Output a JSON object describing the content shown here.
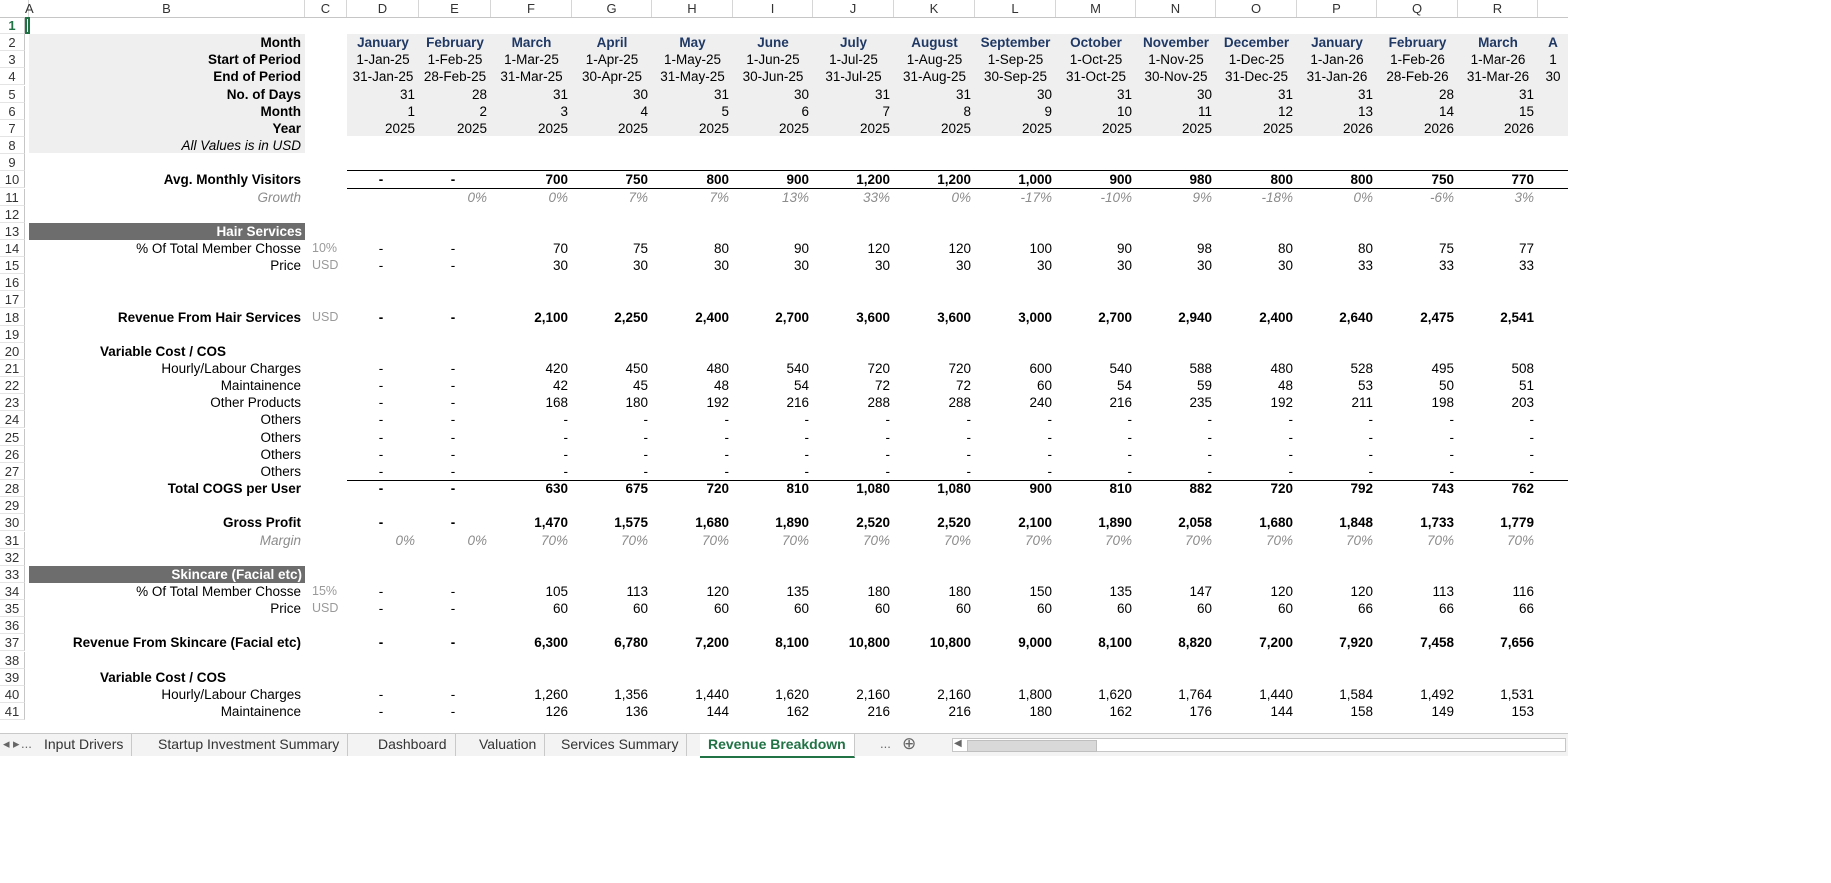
{
  "columns": [
    "A",
    "B",
    "C",
    "D",
    "E",
    "F",
    "G",
    "H",
    "I",
    "J",
    "K",
    "L",
    "M",
    "N",
    "O",
    "P",
    "Q",
    "R"
  ],
  "row_numbers": [
    "1",
    "2",
    "3",
    "4",
    "5",
    "6",
    "7",
    "8",
    "9",
    "10",
    "11",
    "12",
    "13",
    "14",
    "15",
    "16",
    "17",
    "18",
    "19",
    "20",
    "21",
    "22",
    "23",
    "24",
    "25",
    "26",
    "27",
    "28",
    "29",
    "30",
    "31",
    "32",
    "33",
    "34",
    "35",
    "36",
    "37",
    "38",
    "39",
    "40",
    "41"
  ],
  "header_rows": [
    {
      "label": "Month",
      "values": [
        "January",
        "February",
        "March",
        "April",
        "May",
        "June",
        "July",
        "August",
        "September",
        "October",
        "November",
        "December",
        "January",
        "February",
        "March",
        "A"
      ]
    },
    {
      "label": "Start of Period",
      "values": [
        "1-Jan-25",
        "1-Feb-25",
        "1-Mar-25",
        "1-Apr-25",
        "1-May-25",
        "1-Jun-25",
        "1-Jul-25",
        "1-Aug-25",
        "1-Sep-25",
        "1-Oct-25",
        "1-Nov-25",
        "1-Dec-25",
        "1-Jan-26",
        "1-Feb-26",
        "1-Mar-26",
        "1"
      ]
    },
    {
      "label": "End of Period",
      "values": [
        "31-Jan-25",
        "28-Feb-25",
        "31-Mar-25",
        "30-Apr-25",
        "31-May-25",
        "30-Jun-25",
        "31-Jul-25",
        "31-Aug-25",
        "30-Sep-25",
        "31-Oct-25",
        "30-Nov-25",
        "31-Dec-25",
        "31-Jan-26",
        "28-Feb-26",
        "31-Mar-26",
        "30"
      ]
    },
    {
      "label": "No. of Days",
      "values": [
        "31",
        "28",
        "31",
        "30",
        "31",
        "30",
        "31",
        "31",
        "30",
        "31",
        "30",
        "31",
        "31",
        "28",
        "31",
        ""
      ]
    },
    {
      "label": "Month",
      "values": [
        "1",
        "2",
        "3",
        "4",
        "5",
        "6",
        "7",
        "8",
        "9",
        "10",
        "11",
        "12",
        "13",
        "14",
        "15",
        ""
      ]
    },
    {
      "label": "Year",
      "values": [
        "2025",
        "2025",
        "2025",
        "2025",
        "2025",
        "2025",
        "2025",
        "2025",
        "2025",
        "2025",
        "2025",
        "2025",
        "2026",
        "2026",
        "2026",
        ""
      ]
    }
  ],
  "usd_note": "All Values is in USD",
  "visitors": {
    "label": "Avg. Monthly Visitors",
    "values": [
      "-",
      "-",
      "700",
      "750",
      "800",
      "900",
      "1,200",
      "1,200",
      "1,000",
      "900",
      "980",
      "800",
      "800",
      "750",
      "770"
    ]
  },
  "growth": {
    "label": "Growth",
    "values": [
      "",
      "0%",
      "0%",
      "7%",
      "7%",
      "13%",
      "33%",
      "0%",
      "-17%",
      "-10%",
      "9%",
      "-18%",
      "0%",
      "-6%",
      "3%"
    ]
  },
  "hair": {
    "title": "Hair Services",
    "pct": {
      "label": "% Of Total Member Chosse",
      "unit": "10%",
      "values": [
        "-",
        "-",
        "70",
        "75",
        "80",
        "90",
        "120",
        "120",
        "100",
        "90",
        "98",
        "80",
        "80",
        "75",
        "77"
      ]
    },
    "price": {
      "label": "Price",
      "unit": "USD",
      "values": [
        "-",
        "-",
        "30",
        "30",
        "30",
        "30",
        "30",
        "30",
        "30",
        "30",
        "30",
        "30",
        "33",
        "33",
        "33"
      ]
    },
    "revenue": {
      "label": "Revenue From Hair Services",
      "unit": "USD",
      "values": [
        "-",
        "-",
        "2,100",
        "2,250",
        "2,400",
        "2,700",
        "3,600",
        "3,600",
        "3,000",
        "2,700",
        "2,940",
        "2,400",
        "2,640",
        "2,475",
        "2,541"
      ]
    },
    "varcost_label": "Variable Cost / COS",
    "costs": [
      {
        "label": "Hourly/Labour Charges",
        "values": [
          "-",
          "-",
          "420",
          "450",
          "480",
          "540",
          "720",
          "720",
          "600",
          "540",
          "588",
          "480",
          "528",
          "495",
          "508"
        ]
      },
      {
        "label": "Maintainence",
        "values": [
          "-",
          "-",
          "42",
          "45",
          "48",
          "54",
          "72",
          "72",
          "60",
          "54",
          "59",
          "48",
          "53",
          "50",
          "51"
        ]
      },
      {
        "label": "Other Products",
        "values": [
          "-",
          "-",
          "168",
          "180",
          "192",
          "216",
          "288",
          "288",
          "240",
          "216",
          "235",
          "192",
          "211",
          "198",
          "203"
        ]
      },
      {
        "label": "Others",
        "values": [
          "-",
          "-",
          "-",
          "-",
          "-",
          "-",
          "-",
          "-",
          "-",
          "-",
          "-",
          "-",
          "-",
          "-",
          "-"
        ]
      },
      {
        "label": "Others",
        "values": [
          "-",
          "-",
          "-",
          "-",
          "-",
          "-",
          "-",
          "-",
          "-",
          "-",
          "-",
          "-",
          "-",
          "-",
          "-"
        ]
      },
      {
        "label": "Others",
        "values": [
          "-",
          "-",
          "-",
          "-",
          "-",
          "-",
          "-",
          "-",
          "-",
          "-",
          "-",
          "-",
          "-",
          "-",
          "-"
        ]
      },
      {
        "label": "Others",
        "values": [
          "-",
          "-",
          "-",
          "-",
          "-",
          "-",
          "-",
          "-",
          "-",
          "-",
          "-",
          "-",
          "-",
          "-",
          "-"
        ]
      }
    ],
    "total_cogs": {
      "label": "Total COGS per User",
      "values": [
        "-",
        "-",
        "630",
        "675",
        "720",
        "810",
        "1,080",
        "1,080",
        "900",
        "810",
        "882",
        "720",
        "792",
        "743",
        "762"
      ]
    },
    "gross_profit": {
      "label": "Gross Profit",
      "values": [
        "-",
        "-",
        "1,470",
        "1,575",
        "1,680",
        "1,890",
        "2,520",
        "2,520",
        "2,100",
        "1,890",
        "2,058",
        "1,680",
        "1,848",
        "1,733",
        "1,779"
      ]
    },
    "margin": {
      "label": "Margin",
      "values": [
        "0%",
        "0%",
        "70%",
        "70%",
        "70%",
        "70%",
        "70%",
        "70%",
        "70%",
        "70%",
        "70%",
        "70%",
        "70%",
        "70%",
        "70%"
      ]
    }
  },
  "skin": {
    "title": "Skincare (Facial etc)",
    "pct": {
      "label": "% Of Total Member Chosse",
      "unit": "15%",
      "values": [
        "-",
        "-",
        "105",
        "113",
        "120",
        "135",
        "180",
        "180",
        "150",
        "135",
        "147",
        "120",
        "120",
        "113",
        "116"
      ]
    },
    "price": {
      "label": "Price",
      "unit": "USD",
      "values": [
        "-",
        "-",
        "60",
        "60",
        "60",
        "60",
        "60",
        "60",
        "60",
        "60",
        "60",
        "60",
        "66",
        "66",
        "66"
      ]
    },
    "revenue": {
      "label": "Revenue From Skincare (Facial etc)",
      "unit": "",
      "values": [
        "-",
        "-",
        "6,300",
        "6,780",
        "7,200",
        "8,100",
        "10,800",
        "10,800",
        "9,000",
        "8,100",
        "8,820",
        "7,200",
        "7,920",
        "7,458",
        "7,656"
      ]
    },
    "varcost_label": "Variable Cost / COS",
    "costs": [
      {
        "label": "Hourly/Labour Charges",
        "values": [
          "-",
          "-",
          "1,260",
          "1,356",
          "1,440",
          "1,620",
          "2,160",
          "2,160",
          "1,800",
          "1,620",
          "1,764",
          "1,440",
          "1,584",
          "1,492",
          "1,531"
        ]
      },
      {
        "label": "Maintainence",
        "values": [
          "-",
          "-",
          "126",
          "136",
          "144",
          "162",
          "216",
          "216",
          "180",
          "162",
          "176",
          "144",
          "158",
          "149",
          "153"
        ]
      }
    ]
  },
  "sheet_tabs": [
    "Input Drivers",
    "Startup Investment Summary",
    "Dashboard",
    "Valuation",
    "Services Summary",
    "Revenue Breakdown"
  ],
  "active_tab": "Revenue Breakdown",
  "tab_nav": {
    "more_left": "...",
    "more_right": "...",
    "add": "⊕"
  }
}
